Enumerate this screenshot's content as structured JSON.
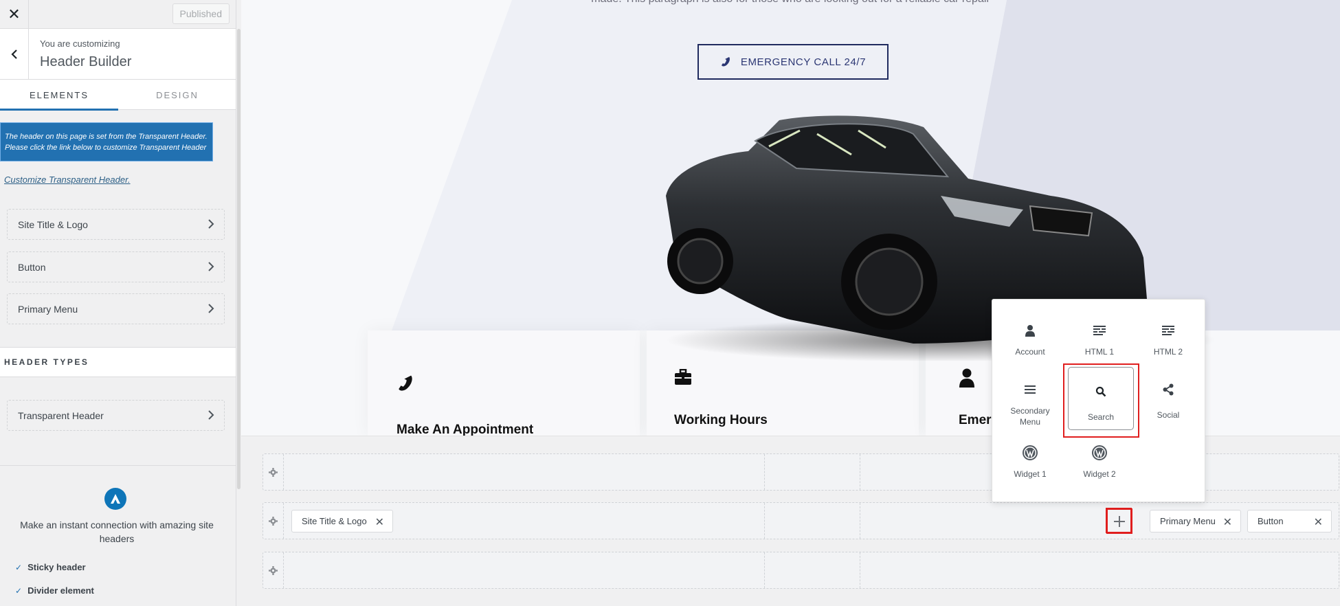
{
  "topbar": {
    "close_label": "✕",
    "published_label": "Published"
  },
  "customizer": {
    "small": "You are customizing",
    "title": "Header Builder"
  },
  "tabs": [
    {
      "label": "ELEMENTS",
      "active": true
    },
    {
      "label": "DESIGN",
      "active": false
    }
  ],
  "notice": {
    "line1": "The header on this page is set from the Transparent Header.",
    "line2": "Please click the link below to customize Transparent Header"
  },
  "customize_link": "Customize Transparent Header.",
  "elements": [
    {
      "label": "Site Title & Logo"
    },
    {
      "label": "Button"
    },
    {
      "label": "Primary Menu"
    }
  ],
  "header_types": {
    "title": "HEADER TYPES",
    "items": [
      {
        "label": "Transparent Header"
      }
    ]
  },
  "promo": {
    "text": "Make an instant connection with amazing site headers",
    "features": [
      "Sticky header",
      "Divider element"
    ]
  },
  "preview": {
    "paragraph": "made. This paragraph is also for those who are looking out for a reliable car repair",
    "emergency_button": "EMERGENCY CALL 24/7",
    "cards": [
      {
        "icon": "phone-icon",
        "title": "Make An Appointment"
      },
      {
        "icon": "briefcase-icon",
        "title": "Working Hours"
      },
      {
        "icon": "user-icon",
        "title": "Emer"
      }
    ],
    "colors": {
      "navy": "#1f2a5e",
      "hero_light": "#eef0f6",
      "hero_dark": "#dfe1ec"
    }
  },
  "builder": {
    "rows": [
      {
        "name": "top",
        "chips": []
      },
      {
        "name": "primary",
        "chips": [
          "Site Title & Logo",
          "Primary Menu",
          "Button"
        ]
      },
      {
        "name": "bottom",
        "chips": []
      }
    ],
    "add_label": "+",
    "remove_label": "✕"
  },
  "popup": {
    "items": [
      {
        "label": "Account",
        "icon": "account-icon"
      },
      {
        "label": "HTML 1",
        "icon": "html-icon"
      },
      {
        "label": "HTML 2",
        "icon": "html-icon"
      },
      {
        "label": "Secondary Menu",
        "icon": "menu-icon"
      },
      {
        "label": "Search",
        "icon": "search-icon",
        "selected": true
      },
      {
        "label": "Social",
        "icon": "share-icon"
      },
      {
        "label": "Widget 1",
        "icon": "wordpress-icon"
      },
      {
        "label": "Widget 2",
        "icon": "wordpress-icon"
      }
    ],
    "highlight_color": "#e01e1e"
  }
}
